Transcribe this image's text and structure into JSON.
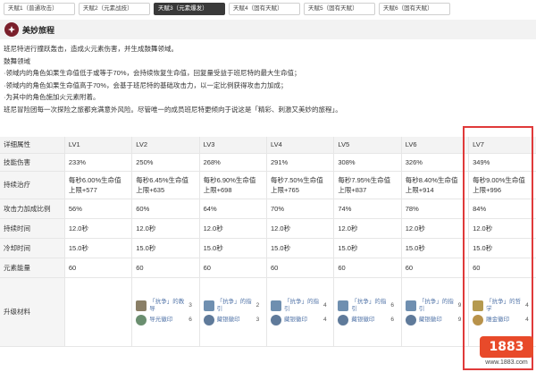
{
  "tabs": [
    {
      "label": "天赋1（普通攻击）",
      "active": false
    },
    {
      "label": "天赋2（元素战技）",
      "active": false
    },
    {
      "label": "天赋3（元素爆发）",
      "active": true
    },
    {
      "label": "天赋4（固有天赋）",
      "active": false
    },
    {
      "label": "天赋5（固有天赋）",
      "active": false
    },
    {
      "label": "天赋6（固有天赋）",
      "active": false
    }
  ],
  "section": {
    "title": "美妙旅程"
  },
  "description": {
    "lines": [
      "班尼特进行撞跃轰击，造成火元素伤害，并生成鼓舞领域。",
      "鼓舞领域",
      "·领域内的角色如果生命值低于或等于70%，会持续恢复生命值，回复量受益于班尼特的最大生命值；",
      "·领域内的角色如果生命值高于70%，会基于班尼特的基础攻击力，以一定比例获得攻击力加成；",
      "·为其中的角色施加火元素附着。",
      "班尼冒险团每一次探险之旅都充满意外风险。尽管唯一的成员班尼特更倾向于说这是「精彩、刺激又美妙的旅程」。"
    ]
  },
  "table": {
    "header_attr": "详细属性",
    "levels": [
      "LV1",
      "LV2",
      "LV3",
      "LV4",
      "LV5",
      "LV6",
      "LV7"
    ],
    "rows": [
      {
        "label": "技能伤害",
        "values": [
          "233%",
          "250%",
          "268%",
          "291%",
          "308%",
          "326%",
          "349%"
        ]
      },
      {
        "label": "持续治疗",
        "values": [
          [
            "每秒6.00%生命值",
            "上限+577"
          ],
          [
            "每秒6.45%生命值",
            "上限+635"
          ],
          [
            "每秒6.90%生命值",
            "上限+698"
          ],
          [
            "每秒7.50%生命值",
            "上限+765"
          ],
          [
            "每秒7.95%生命值",
            "上限+837"
          ],
          [
            "每秒8.40%生命值",
            "上限+914"
          ],
          [
            "每秒9.00%生命值",
            "上限+996"
          ]
        ]
      },
      {
        "label": "攻击力加成比例",
        "values": [
          "56%",
          "60%",
          "64%",
          "70%",
          "74%",
          "78%",
          "84%"
        ]
      },
      {
        "label": "持续时间",
        "values": [
          "12.0秒",
          "12.0秒",
          "12.0秒",
          "12.0秒",
          "12.0秒",
          "12.0秒",
          "12.0秒"
        ]
      },
      {
        "label": "冷却时间",
        "values": [
          "15.0秒",
          "15.0秒",
          "15.0秒",
          "15.0秒",
          "15.0秒",
          "15.0秒",
          "15.0秒"
        ]
      },
      {
        "label": "元素能量",
        "values": [
          "60",
          "60",
          "60",
          "60",
          "60",
          "60",
          "60"
        ]
      }
    ],
    "materials_label": "升级材料",
    "materials": [
      [],
      [
        {
          "name": "「抗争」的教导",
          "count": "3",
          "icon": "book-icon"
        },
        {
          "name": "导光徽印",
          "count": "6",
          "icon": "gem-icon"
        }
      ],
      [
        {
          "name": "「抗争」的指引",
          "count": "2",
          "icon": "book-icon"
        },
        {
          "name": "藏银徽印",
          "count": "3",
          "icon": "gem-icon"
        }
      ],
      [
        {
          "name": "「抗争」的指引",
          "count": "4",
          "icon": "book-icon"
        },
        {
          "name": "藏银徽印",
          "count": "4",
          "icon": "gem-icon"
        }
      ],
      [
        {
          "name": "「抗争」的指引",
          "count": "6",
          "icon": "book-icon"
        },
        {
          "name": "藏银徽印",
          "count": "6",
          "icon": "gem-icon"
        }
      ],
      [
        {
          "name": "「抗争」的指引",
          "count": "9",
          "icon": "book-icon"
        },
        {
          "name": "藏银徽印",
          "count": "9",
          "icon": "gem-icon"
        }
      ],
      [
        {
          "name": "「抗争」的哲学",
          "count": "4",
          "icon": "book-icon"
        },
        {
          "name": "雕金徽印",
          "count": "4",
          "icon": "gem-icon"
        }
      ]
    ]
  },
  "watermark": {
    "badge": "1883",
    "url": "www.1883.com"
  },
  "colors": {
    "highlight_border": "#e03a3a",
    "active_tab": "#3a3a3a",
    "talent_icon": "#7a1f2b"
  }
}
